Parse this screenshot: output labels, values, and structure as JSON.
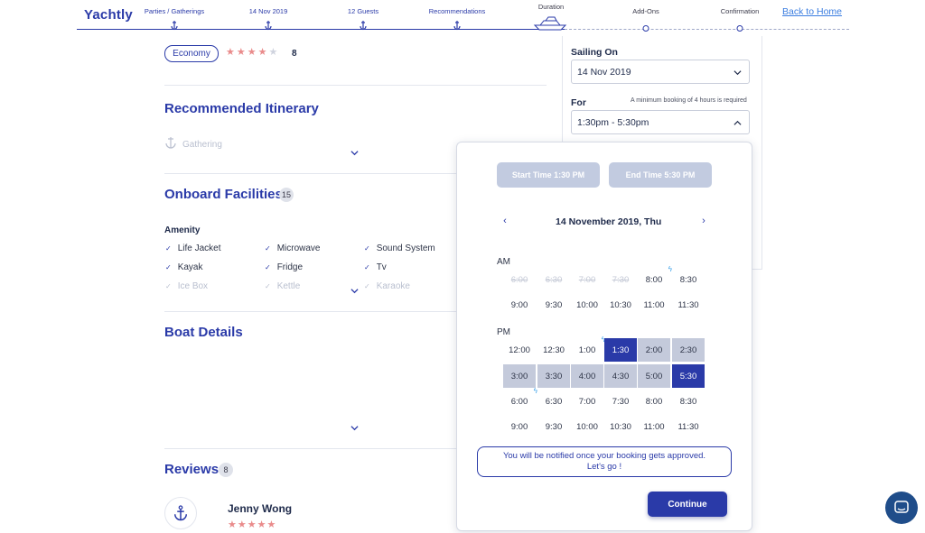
{
  "brand": {
    "logo_text": "Yachtly"
  },
  "progress": {
    "steps": [
      {
        "label": "Parties / Gatherings"
      },
      {
        "label": "14 Nov 2019"
      },
      {
        "label": "12 Guests"
      },
      {
        "label": "Recommendations"
      },
      {
        "label": "Duration"
      },
      {
        "label": "Add-Ons"
      },
      {
        "label": "Confirmation"
      }
    ],
    "back_home": "Back to Home"
  },
  "listing": {
    "class_badge": "Economy",
    "rating": 4,
    "rating_max": 5,
    "rating_count": "8"
  },
  "itinerary": {
    "title": "Recommended Itinerary",
    "preview": "Gathering"
  },
  "facilities": {
    "title": "Onboard Facilities",
    "count": "15",
    "amenity_heading": "Amenity",
    "items": [
      "Life Jacket",
      "Microwave",
      "Sound System",
      "Kayak",
      "Fridge",
      "Tv",
      "Ice Box",
      "Kettle",
      "Karaoke"
    ]
  },
  "boat_details": {
    "title": "Boat Details"
  },
  "reviews": {
    "title": "Reviews",
    "count": "8",
    "reviewer_name": "Jenny Wong",
    "reviewer_stars": "★★★★★"
  },
  "booking": {
    "sailing_on_label": "Sailing On",
    "sailing_on_value": "14 Nov 2019",
    "for_label": "For",
    "min_note": "A minimum booking of 4 hours is required",
    "for_value": "1:30pm - 5:30pm"
  },
  "time_picker": {
    "start_btn": "Start Time 1:30 PM",
    "end_btn": "End Time 5:30 PM",
    "date_title": "14 November 2019, Thu",
    "am_label": "AM",
    "pm_label": "PM",
    "am_rows": [
      [
        {
          "t": "6:00",
          "s": "disabled"
        },
        {
          "t": "6:30",
          "s": "disabled"
        },
        {
          "t": "7:00",
          "s": "disabled"
        },
        {
          "t": "7:30",
          "s": "disabled"
        },
        {
          "t": "8:00",
          "s": "bolt"
        },
        {
          "t": "8:30",
          "s": ""
        }
      ],
      [
        {
          "t": "9:00",
          "s": ""
        },
        {
          "t": "9:30",
          "s": ""
        },
        {
          "t": "10:00",
          "s": ""
        },
        {
          "t": "10:30",
          "s": ""
        },
        {
          "t": "11:00",
          "s": ""
        },
        {
          "t": "11:30",
          "s": ""
        }
      ]
    ],
    "pm_rows": [
      [
        {
          "t": "12:00",
          "s": ""
        },
        {
          "t": "12:30",
          "s": ""
        },
        {
          "t": "1:00",
          "s": "bolt"
        },
        {
          "t": "1:30",
          "s": "sel"
        },
        {
          "t": "2:00",
          "s": "range"
        },
        {
          "t": "2:30",
          "s": "range"
        }
      ],
      [
        {
          "t": "3:00",
          "s": "range"
        },
        {
          "t": "3:30",
          "s": "range"
        },
        {
          "t": "4:00",
          "s": "range"
        },
        {
          "t": "4:30",
          "s": "range"
        },
        {
          "t": "5:00",
          "s": "range"
        },
        {
          "t": "5:30",
          "s": "sel"
        }
      ],
      [
        {
          "t": "6:00",
          "s": "bolt"
        },
        {
          "t": "6:30",
          "s": ""
        },
        {
          "t": "7:00",
          "s": ""
        },
        {
          "t": "7:30",
          "s": ""
        },
        {
          "t": "8:00",
          "s": ""
        },
        {
          "t": "8:30",
          "s": ""
        }
      ],
      [
        {
          "t": "9:00",
          "s": ""
        },
        {
          "t": "9:30",
          "s": ""
        },
        {
          "t": "10:00",
          "s": ""
        },
        {
          "t": "10:30",
          "s": ""
        },
        {
          "t": "11:00",
          "s": ""
        },
        {
          "t": "11:30",
          "s": ""
        }
      ]
    ],
    "notify_line1": "You will be notified once your booking gets approved.",
    "notify_line2": "Let's go !",
    "continue_label": "Continue"
  },
  "colors": {
    "primary": "#2a3aa8",
    "range": "#c4cadb",
    "star": "#e98b8b",
    "chat": "#1f4d8a"
  },
  "icons": [
    "anchor-icon",
    "chevron-down-icon",
    "chevron-up-icon",
    "chevron-left-icon",
    "chevron-right-icon",
    "check-icon",
    "yacht-icon",
    "bolt-icon",
    "chat-icon"
  ]
}
